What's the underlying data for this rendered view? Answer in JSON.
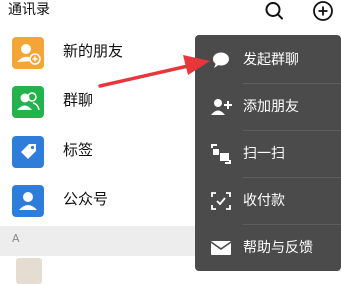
{
  "header": {
    "title": "通讯录"
  },
  "contacts_list": {
    "items": [
      {
        "label": "新的朋友",
        "icon": "new-friends-icon",
        "color": "#f3a536"
      },
      {
        "label": "群聊",
        "icon": "group-chat-icon",
        "color": "#23b24b"
      },
      {
        "label": "标签",
        "icon": "tag-icon",
        "color": "#2e7ddb"
      },
      {
        "label": "公众号",
        "icon": "official-account-icon",
        "color": "#2e7ddb"
      }
    ],
    "section_letter": "A"
  },
  "popup_menu": {
    "items": [
      {
        "label": "发起群聊",
        "icon": "chat-bubble-icon"
      },
      {
        "label": "添加朋友",
        "icon": "add-friend-icon"
      },
      {
        "label": "扫一扫",
        "icon": "scan-icon"
      },
      {
        "label": "收付款",
        "icon": "payment-icon"
      },
      {
        "label": "帮助与反馈",
        "icon": "mail-icon"
      }
    ],
    "background": "#4b4b4b"
  },
  "annotation": {
    "arrow_color": "#e8373b"
  }
}
